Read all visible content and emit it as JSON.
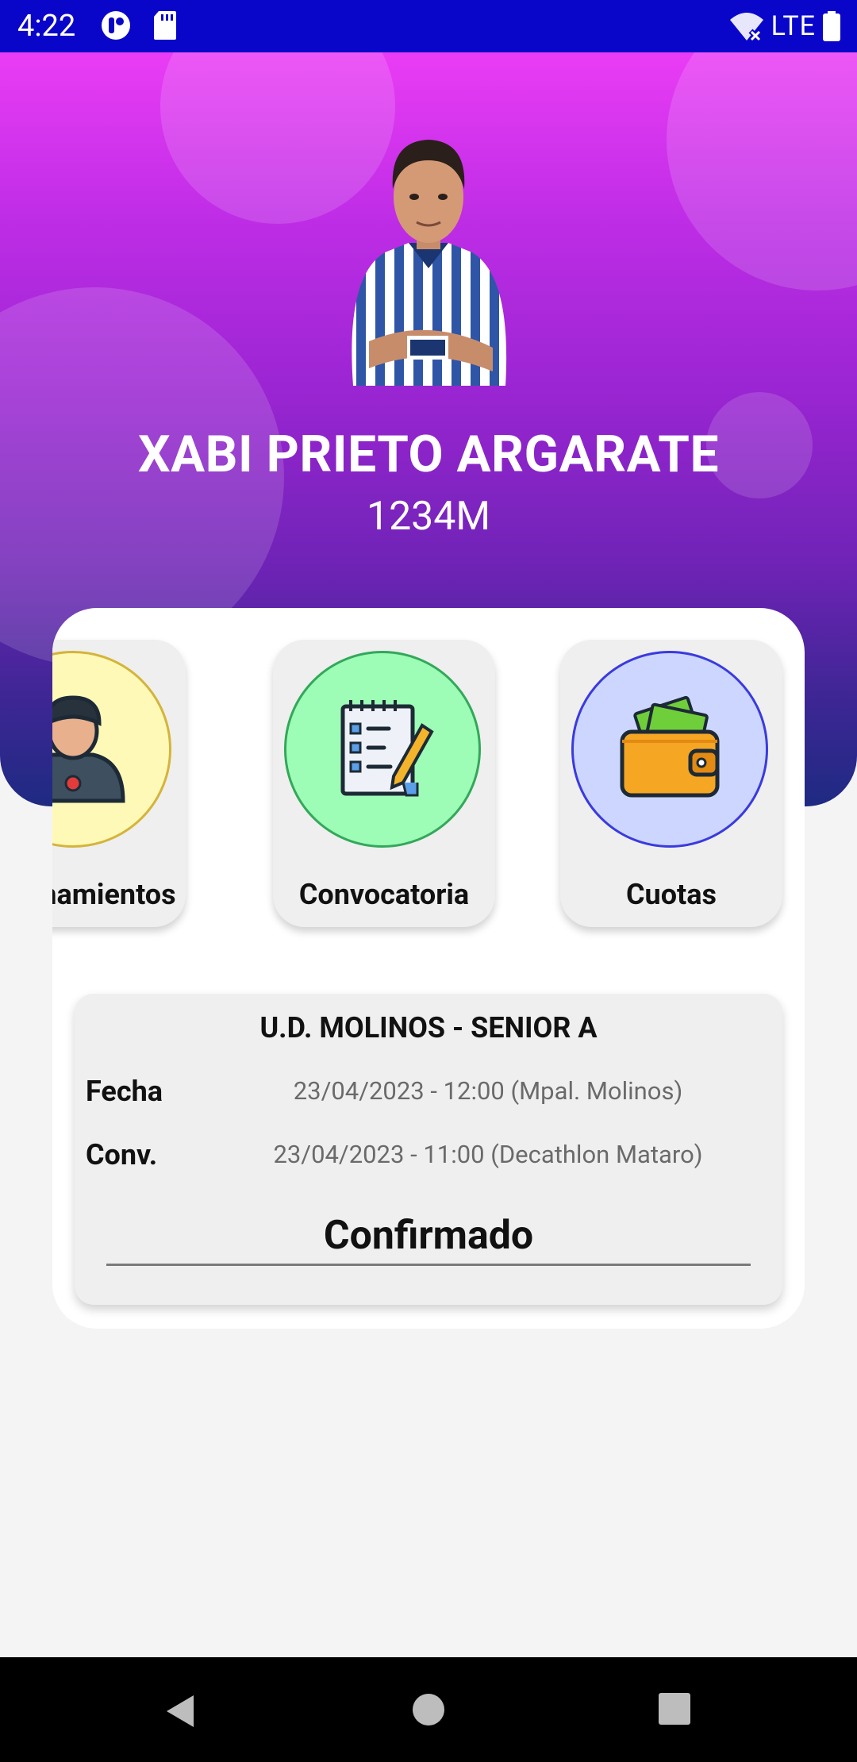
{
  "status_bar": {
    "time": "4:22",
    "network": "LTE",
    "icons": [
      "app-notification-icon",
      "sd-card-icon",
      "wifi-off-icon",
      "battery-icon"
    ]
  },
  "profile": {
    "name": "XABI PRIETO ARGARATE",
    "code": "1234M"
  },
  "menu": {
    "items": [
      {
        "label": "Entrenamientos",
        "icon": "coach-icon",
        "bg": "#fff9b8",
        "border": "#d4b43a"
      },
      {
        "label": "Convocatoria",
        "icon": "checklist-icon",
        "bg": "#9dfcb6",
        "border": "#33a85a"
      },
      {
        "label": "Cuotas",
        "icon": "wallet-icon",
        "bg": "#cdd6ff",
        "border": "#3a3ae0"
      }
    ]
  },
  "match": {
    "title": "U.D. MOLINOS - SENIOR A",
    "fecha_label": "Fecha",
    "fecha_value": "23/04/2023 - 12:00 (Mpal. Molinos)",
    "conv_label": "Conv.",
    "conv_value": "23/04/2023 - 11:00 (Decathlon Mataro)",
    "status": "Confirmado"
  },
  "nav_bar": {
    "buttons": [
      "back-icon",
      "home-icon",
      "recents-icon"
    ]
  },
  "colors": {
    "status_bar": "#0a06c9",
    "header_top": "#ea3cf5",
    "header_bottom": "#1e2a82"
  }
}
